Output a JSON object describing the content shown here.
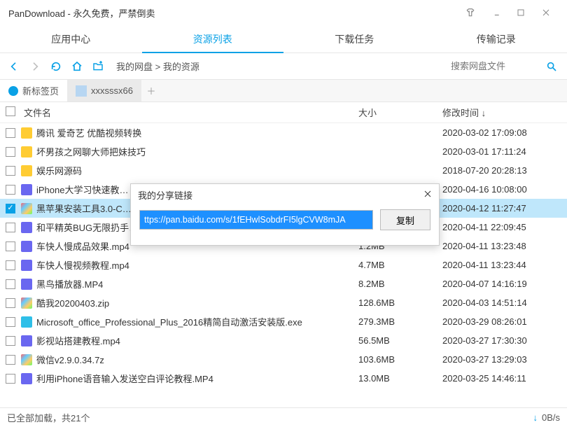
{
  "window": {
    "title": "PanDownload - 永久免费，严禁倒卖"
  },
  "tabs": {
    "items": [
      "应用中心",
      "资源列表",
      "下载任务",
      "传输记录"
    ],
    "activeIndex": 1
  },
  "toolbar": {
    "breadcrumb": "我的网盘 > 我的资源",
    "search_placeholder": "搜索网盘文件"
  },
  "session": {
    "newtab_label": "新标签页",
    "user_label": "xxxsssx66"
  },
  "columns": {
    "name": "文件名",
    "size": "大小",
    "date": "修改时间 ↓"
  },
  "rows": [
    {
      "icon": "folder",
      "name": "腾讯 爱奇艺 优酷视频转换",
      "size": "",
      "date": "2020-03-02 17:09:08",
      "checked": false
    },
    {
      "icon": "folder",
      "name": "坏男孩之网聊大师把妹技巧",
      "size": "",
      "date": "2020-03-01 17:11:24",
      "checked": false
    },
    {
      "icon": "folder",
      "name": "娱乐网源码",
      "size": "",
      "date": "2018-07-20 20:28:13",
      "checked": false
    },
    {
      "icon": "video",
      "name": "iPhone大学习快速教…",
      "size": "",
      "date": "2020-04-16 10:08:00",
      "checked": false
    },
    {
      "icon": "multi",
      "name": "黑苹果安装工具3.0-C…",
      "size": "",
      "date": "2020-04-12 11:27:47",
      "checked": true
    },
    {
      "icon": "video",
      "name": "和平精英BUG无限扔手…",
      "size": "",
      "date": "2020-04-11 22:09:45",
      "checked": false
    },
    {
      "icon": "video",
      "name": "车快人慢成品效果.mp4",
      "size": "1.2MB",
      "date": "2020-04-11 13:23:48",
      "checked": false
    },
    {
      "icon": "video",
      "name": "车快人慢视频教程.mp4",
      "size": "4.7MB",
      "date": "2020-04-11 13:23:44",
      "checked": false
    },
    {
      "icon": "video",
      "name": "黑鸟播放器.MP4",
      "size": "8.2MB",
      "date": "2020-04-07 14:16:19",
      "checked": false
    },
    {
      "icon": "multi",
      "name": "酷我20200403.zip",
      "size": "128.6MB",
      "date": "2020-04-03 14:51:14",
      "checked": false
    },
    {
      "icon": "app",
      "name": "Microsoft_office_Professional_Plus_2016精简自动激活安装版.exe",
      "size": "279.3MB",
      "date": "2020-03-29 08:26:01",
      "checked": false
    },
    {
      "icon": "video",
      "name": "影视站搭建教程.mp4",
      "size": "56.5MB",
      "date": "2020-03-27 17:30:30",
      "checked": false
    },
    {
      "icon": "multi",
      "name": "微信v2.9.0.34.7z",
      "size": "103.6MB",
      "date": "2020-03-27 13:29:03",
      "checked": false
    },
    {
      "icon": "video",
      "name": "利用iPhone语音输入发送空白评论教程.MP4",
      "size": "13.0MB",
      "date": "2020-03-25 14:46:11",
      "checked": false
    }
  ],
  "dialog": {
    "title": "我的分享链接",
    "link": "ttps://pan.baidu.com/s/1fEHwlSobdrFI5lgCVW8mJA",
    "copy_label": "复制"
  },
  "status": {
    "text": "已全部加载，共21个",
    "speed": "0B/s"
  }
}
